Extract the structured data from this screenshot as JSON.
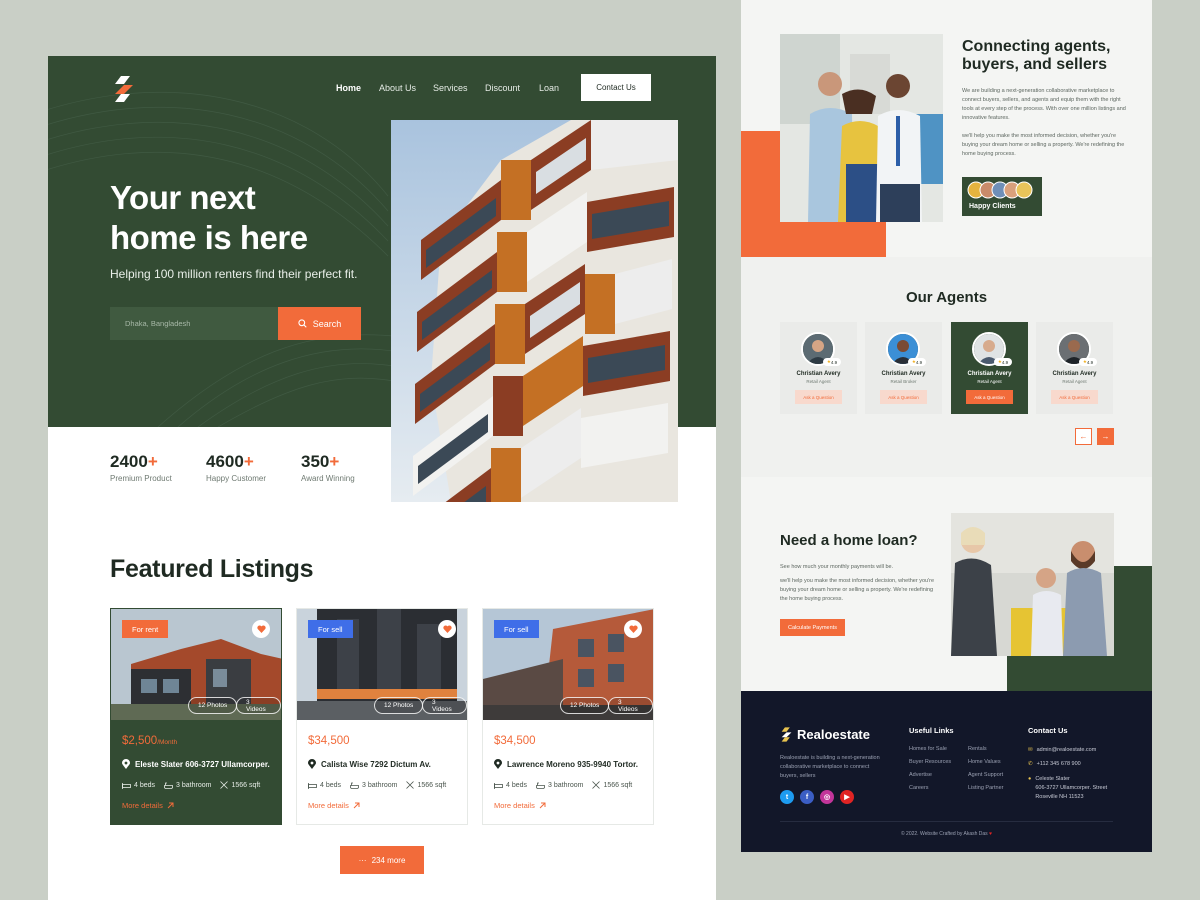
{
  "colors": {
    "green": "#334b33",
    "accent": "#f26b3a",
    "blue": "#3f6ee8",
    "navy": "#121729"
  },
  "nav": {
    "items": [
      "Home",
      "About Us",
      "Services",
      "Discount",
      "Loan"
    ],
    "contact": "Contact Us"
  },
  "hero": {
    "title_line1": "Your next",
    "title_line2": "home is here",
    "subtitle": "Helping 100 million renters find their perfect fit.",
    "search_value": "Dhaka, Bangladesh",
    "search_button": "Search"
  },
  "stats": [
    {
      "num": "2400",
      "plus": "+",
      "label": "Premium Product"
    },
    {
      "num": "4600",
      "plus": "+",
      "label": "Happy Customer"
    },
    {
      "num": "350",
      "plus": "+",
      "label": "Award Winning"
    }
  ],
  "featured": {
    "title": "Featured Listings",
    "more_button": "234 more",
    "cards": [
      {
        "badge": "For rent",
        "badge_color": "#f26b3a",
        "photos": "12 Photos",
        "videos": "3 Videos",
        "price": "$2,500",
        "price_unit": "/Month",
        "address": "Eleste Slater 606-3727 Ullamcorper.",
        "beds": "4 beds",
        "bath": "3 bathroom",
        "area": "1566 sqft",
        "more": "More details"
      },
      {
        "badge": "For sell",
        "badge_color": "#3f6ee8",
        "photos": "12 Photos",
        "videos": "3 Videos",
        "price": "$34,500",
        "price_unit": "",
        "address": "Calista Wise 7292 Dictum Av.",
        "beds": "4 beds",
        "bath": "3 bathroom",
        "area": "1566 sqft",
        "more": "More details"
      },
      {
        "badge": "For sell",
        "badge_color": "#3f6ee8",
        "photos": "12 Photos",
        "videos": "3 Videos",
        "price": "$34,500",
        "price_unit": "",
        "address": "Lawrence Moreno 935-9940 Tortor.",
        "beds": "4 beds",
        "bath": "3 bathroom",
        "area": "1566 sqft",
        "more": "More details"
      }
    ]
  },
  "connect": {
    "title": "Connecting agents, buyers, and sellers",
    "p1": "We are building a next-generation collaborative marketplace to connect buyers, sellers, and agents and equip them with the right tools at every step of the process. With over one million listings and innovative features.",
    "p2": "we'll help you make the most informed decision, whether you're buying your dream home or selling a property. We're redefining the home buying process.",
    "happy_label": "Happy Clients"
  },
  "agents": {
    "title": "Our Agents",
    "rating": "4.9",
    "list": [
      {
        "name": "Christian Avery",
        "role": "Retail Agent",
        "ask": "Ask a Question"
      },
      {
        "name": "Christian Avery",
        "role": "Retail Broker",
        "ask": "Ask a Question"
      },
      {
        "name": "Christian Avery",
        "role": "Retail Agent",
        "ask": "Ask a Question"
      },
      {
        "name": "Christian Avery",
        "role": "Retail Agent",
        "ask": "Ask a Question"
      }
    ],
    "prev_icon": "←",
    "next_icon": "→"
  },
  "loan": {
    "title": "Need a home loan?",
    "p1": "See how much your monthly payments will be.",
    "p2": "we'll help you make the most informed decision, whether you're buying your dream home or selling a property. We're redefining the home buying process.",
    "button": "Calculate Payments"
  },
  "footer": {
    "brand": "Realoestate",
    "desc": "Realoestate is building a next-generation collaborative marketplace to connect buyers, sellers",
    "useful_title": "Useful Links",
    "links_col1": [
      "Homes for Sale",
      "Buyer Resources",
      "Advertise",
      "Careers"
    ],
    "links_col2": [
      "Rentals",
      "Home Values",
      "Agent Support",
      "Listing Partner"
    ],
    "contact_title": "Contact Us",
    "email": "admin@realoestate.com",
    "phone": "+112 345 678 900",
    "address_line1": "Celeste Slater",
    "address_line2": "606-3727 Ullamcorper. Street",
    "address_line3": "Roseville NH 11523",
    "copyright": "© 2022. Website Crafted by Akash Das",
    "social_icons": [
      "twitter-icon",
      "facebook-icon",
      "instagram-icon",
      "youtube-icon"
    ]
  }
}
